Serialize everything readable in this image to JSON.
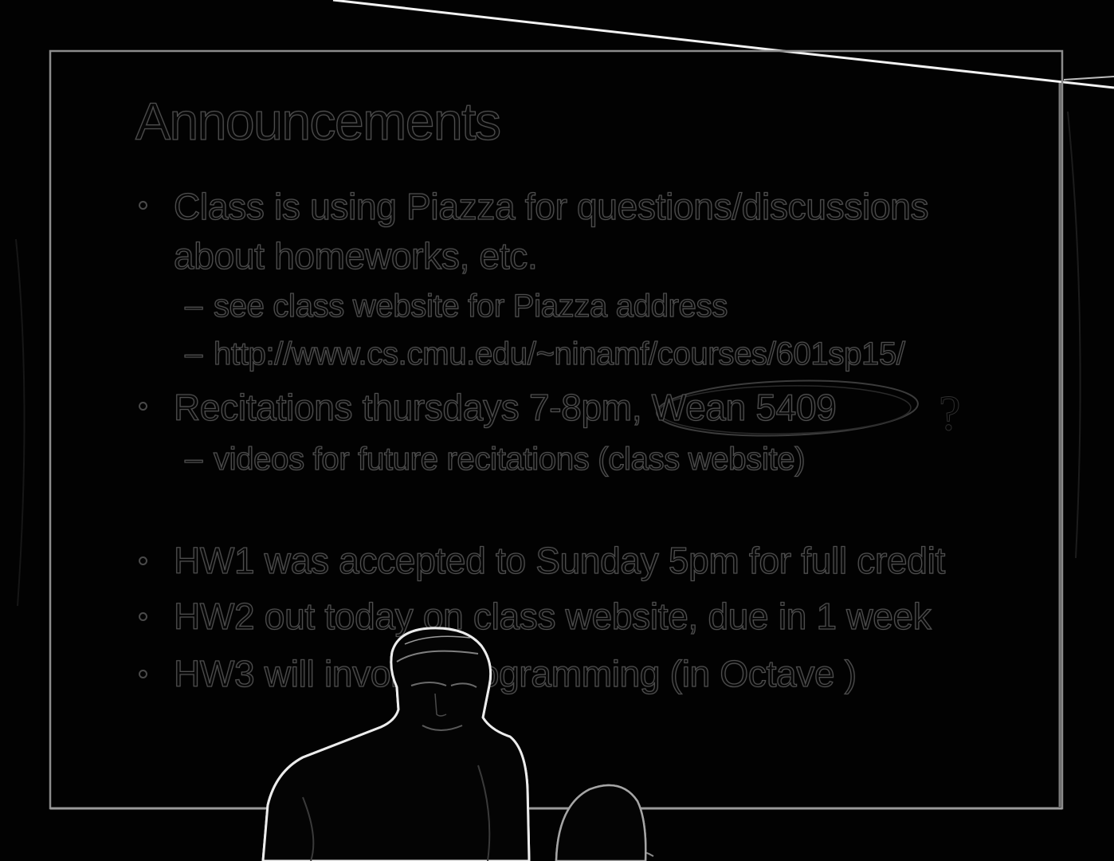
{
  "slide": {
    "title": "Announcements",
    "bullet1_line1": "Class is using Piazza for questions/discussions",
    "bullet1_line2": "about homeworks, etc.",
    "sub1_dash": "–",
    "sub1": "see class website for Piazza address",
    "sub2_dash": "–",
    "sub2": "http://www.cs.cmu.edu/~ninamf/courses/601sp15/",
    "bullet2": "Recitations thursdays 7-8pm, Wean 5409",
    "sub3_dash": "–",
    "sub3": "videos for future recitations (class website)",
    "bullet3": "HW1 was accepted to Sunday 5pm for full credit",
    "bullet4": "HW2 out today on class website, due in 1 week",
    "bullet5": "HW3 will involve programming (in Octave )",
    "handwritten_mark": "?"
  },
  "colors": {
    "background": "#000000",
    "edge_highlight": "#e8e8e8",
    "slide_outline": "#8a8a8a",
    "text_edge": "#4d4d4d"
  }
}
